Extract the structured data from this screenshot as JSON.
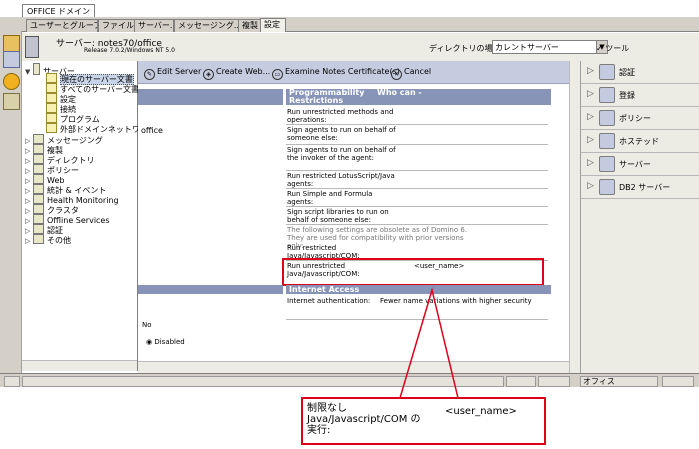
{
  "window_tab": "OFFICE ドメイン",
  "tabs": [
    "ユーザーとグループ",
    "ファイル",
    "サーバー...",
    "メッセージング...",
    "複製",
    "設定"
  ],
  "header": {
    "server_label": "サーバー: notes70/office",
    "release": "Release 7.0.2/Windows NT 5.0",
    "directory_label": "ディレクトリの場所:",
    "directory_value": "カレントサーバー",
    "tools_label": "ツール"
  },
  "tree": {
    "root": "サーバー",
    "children": [
      "現在のサーバー文書",
      "すべてのサーバー文書",
      "設定",
      "接続",
      "プログラム",
      "外部ドメインネットワーク"
    ],
    "items": [
      "メッセージング",
      "複製",
      "ディレクトリ",
      "ポリシー",
      "Web",
      "統計 & イベント",
      "Health Monitoring",
      "クラスタ",
      "Offline Services",
      "認証",
      "その他"
    ]
  },
  "actions": [
    "Edit Server",
    "Create Web...",
    "Examine Notes Certificate(s)",
    "Cancel"
  ],
  "content": {
    "left_text_office": "office",
    "left_text_no": "No",
    "disabled_label": "Disabled",
    "section1_col1": "Programmability Restrictions",
    "section1_col2": "Who can -",
    "rows": [
      "Run unrestricted methods and operations:",
      "Sign agents to run on behalf of someone else:",
      "Sign agents to run on behalf of the invoker of the agent:",
      "Run restricted LotusScript/Java agents:",
      "Run Simple and Formula agents:",
      "Sign script libraries to run on behalf of someone else:"
    ],
    "obsolete_note": "The following settings are obsolete as of Domino 6. They are used for compatibility with prior versions only:",
    "row_restricted": "Run restricted Java/Javascript/COM:",
    "row_unrestricted": "Run unrestricted Java/Javascript/COM:",
    "user_name": "<user_name>",
    "section2": "Internet Access",
    "internet_auth_label": "Internet authentication:",
    "internet_auth_value": "Fewer name variations with higher security"
  },
  "right_panel": [
    "認証",
    "登録",
    "ポリシー",
    "ホステッド",
    "サーバー",
    "DB2 サーバー"
  ],
  "status_bar": {
    "location": "オフィス"
  },
  "callout": {
    "line1": "制限なし",
    "line2": "Java/Javascript/COM の",
    "line3": "実行:",
    "user_name": "<user_name>"
  },
  "colors": {
    "section_header": "#8793b7",
    "action_bar": "#c6cce0",
    "highlight_red": "#e0001a"
  }
}
